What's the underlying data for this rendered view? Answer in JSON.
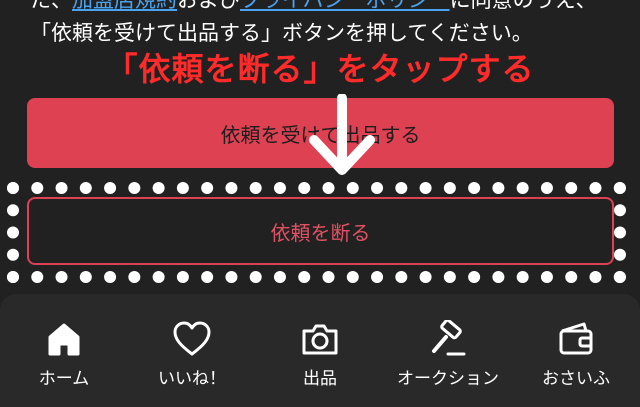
{
  "instructions": {
    "line1_prefix": "た、",
    "terms_link": "加盟店規約",
    "line1_mid": "および",
    "privacy_link": "プライバシーポリシー",
    "line1_suffix": "に同意のうえ、",
    "line2": "「依頼を受けて出品する」ボタンを押してください。"
  },
  "overlay": {
    "caption": "「依頼を断る」をタップする",
    "caption_color": "#ff2a2a"
  },
  "buttons": {
    "accept_label": "依頼を受けて出品する",
    "decline_label": "依頼を断る",
    "accent_color": "#dd4152"
  },
  "tabbar": {
    "items": [
      {
        "label": "ホーム",
        "icon": "home-icon"
      },
      {
        "label": "いいね！",
        "icon": "heart-icon"
      },
      {
        "label": "出品",
        "icon": "camera-icon"
      },
      {
        "label": "オークション",
        "icon": "gavel-icon"
      },
      {
        "label": "おさいふ",
        "icon": "wallet-icon"
      }
    ]
  }
}
